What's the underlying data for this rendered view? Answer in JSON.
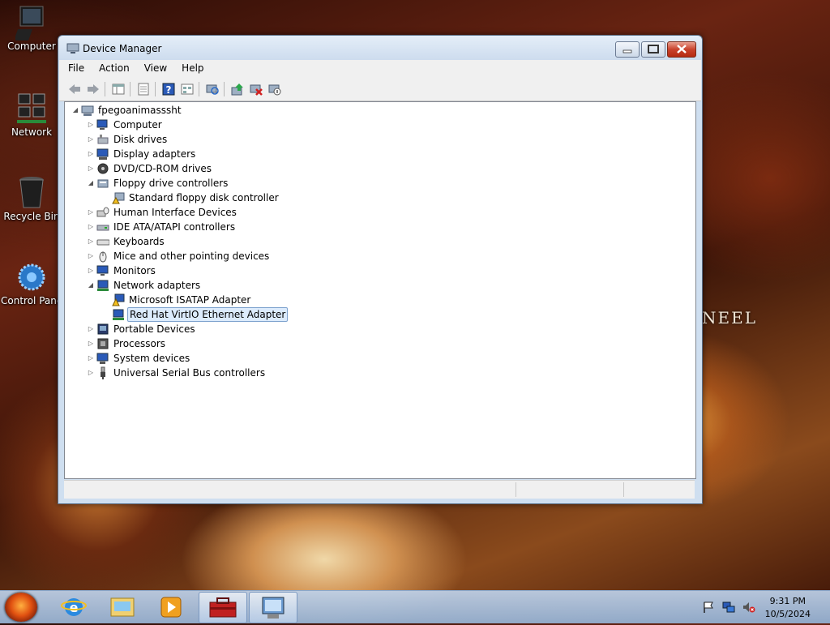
{
  "desktop": {
    "icons": [
      {
        "label": "Computer"
      },
      {
        "label": "Network"
      },
      {
        "label": "Recycle Bin"
      },
      {
        "label": "Control Panel"
      }
    ],
    "wallpaper_text": "NEEL"
  },
  "window": {
    "title": "Device Manager",
    "menu": [
      "File",
      "Action",
      "View",
      "Help"
    ],
    "tree": {
      "root": "fpegoanimasssht",
      "items": [
        {
          "label": "Computer",
          "expanded": false,
          "icon": "computer-icon"
        },
        {
          "label": "Disk drives",
          "expanded": false,
          "icon": "disk-drive-icon"
        },
        {
          "label": "Display adapters",
          "expanded": false,
          "icon": "display-adapter-icon"
        },
        {
          "label": "DVD/CD-ROM drives",
          "expanded": false,
          "icon": "dvd-drive-icon"
        },
        {
          "label": "Floppy drive controllers",
          "expanded": true,
          "icon": "floppy-controller-icon",
          "children": [
            {
              "label": "Standard floppy disk controller",
              "icon": "floppy-controller-warning-icon"
            }
          ]
        },
        {
          "label": "Human Interface Devices",
          "expanded": false,
          "icon": "hid-icon"
        },
        {
          "label": "IDE ATA/ATAPI controllers",
          "expanded": false,
          "icon": "ide-controller-icon"
        },
        {
          "label": "Keyboards",
          "expanded": false,
          "icon": "keyboard-icon"
        },
        {
          "label": "Mice and other pointing devices",
          "expanded": false,
          "icon": "mouse-icon"
        },
        {
          "label": "Monitors",
          "expanded": false,
          "icon": "monitor-icon"
        },
        {
          "label": "Network adapters",
          "expanded": true,
          "icon": "network-adapter-icon",
          "children": [
            {
              "label": "Microsoft ISATAP Adapter",
              "icon": "network-adapter-warning-icon"
            },
            {
              "label": "Red Hat VirtIO Ethernet Adapter",
              "icon": "network-adapter-icon",
              "selected": true
            }
          ]
        },
        {
          "label": "Portable Devices",
          "expanded": false,
          "icon": "portable-device-icon"
        },
        {
          "label": "Processors",
          "expanded": false,
          "icon": "processor-icon"
        },
        {
          "label": "System devices",
          "expanded": false,
          "icon": "system-device-icon"
        },
        {
          "label": "Universal Serial Bus controllers",
          "expanded": false,
          "icon": "usb-icon"
        }
      ]
    }
  },
  "taskbar": {
    "time": "9:31 PM",
    "date": "10/5/2024"
  }
}
